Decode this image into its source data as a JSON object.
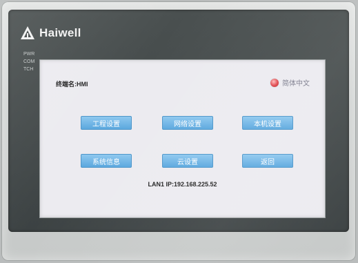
{
  "device": {
    "brand": "Haiwell",
    "leds": [
      "PWR",
      "COM",
      "TCH"
    ]
  },
  "screen": {
    "terminal_name": "终端名:HMI",
    "language": "简体中文",
    "buttons": {
      "project_settings": "工程设置",
      "network_settings": "网络设置",
      "local_settings": "本机设置",
      "system_info": "系统信息",
      "cloud_settings": "云设置",
      "back": "返回"
    },
    "lan_ip": "LAN1 IP:192.168.225.52"
  },
  "colors": {
    "button": "#6bb3e6",
    "radio": "#e0464b",
    "screen_bg": "#ecebf0",
    "bezel": "#3f4546"
  }
}
